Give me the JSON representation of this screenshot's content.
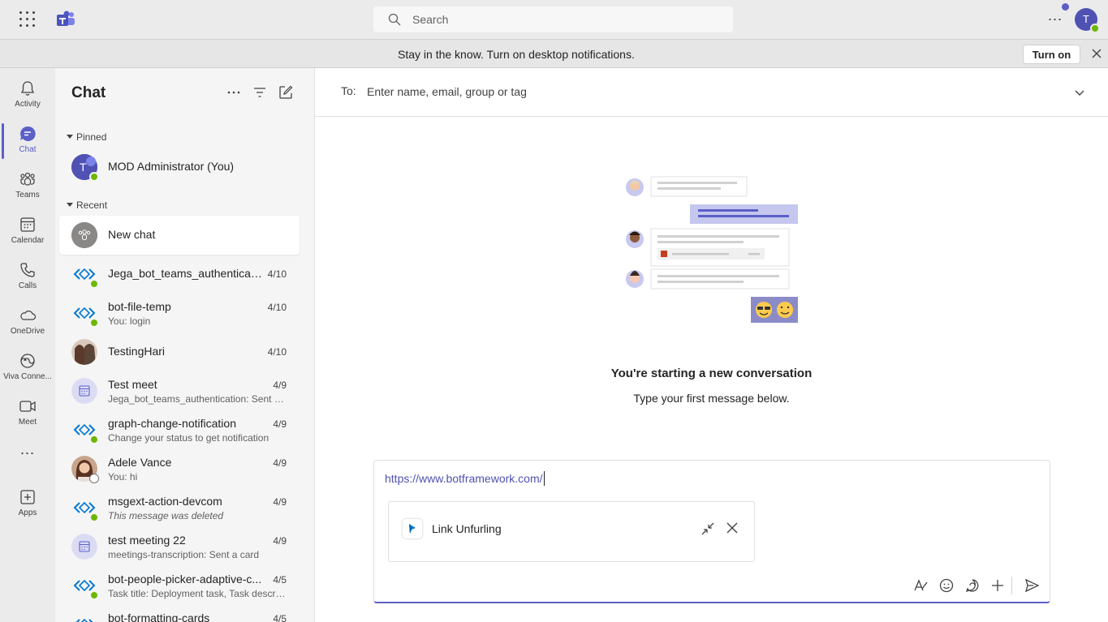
{
  "search": {
    "placeholder": "Search"
  },
  "banner": {
    "text": "Stay in the know. Turn on desktop notifications.",
    "button": "Turn on"
  },
  "user": {
    "initial": "T"
  },
  "rail": [
    {
      "label": "Activity",
      "icon": "bell-icon"
    },
    {
      "label": "Chat",
      "icon": "chat-icon",
      "active": true
    },
    {
      "label": "Teams",
      "icon": "teams-icon"
    },
    {
      "label": "Calendar",
      "icon": "calendar-icon"
    },
    {
      "label": "Calls",
      "icon": "phone-icon"
    },
    {
      "label": "OneDrive",
      "icon": "cloud-icon"
    },
    {
      "label": "Viva Conne...",
      "icon": "viva-icon"
    },
    {
      "label": "Meet",
      "icon": "video-icon"
    },
    {
      "label": "Apps",
      "icon": "add-app-icon"
    }
  ],
  "chatlist": {
    "title": "Chat",
    "pinned_label": "Pinned",
    "recent_label": "Recent",
    "pinned": {
      "name": "MOD Administrator (You)",
      "initial": "T"
    },
    "new_chat": "New chat",
    "items": [
      {
        "name": "Jega_bot_teams_authenticati...",
        "date": "4/10",
        "sub": ""
      },
      {
        "name": "bot-file-temp",
        "date": "4/10",
        "sub": "You: login"
      },
      {
        "name": "TestingHari",
        "date": "4/10",
        "sub": ""
      },
      {
        "name": "Test meet",
        "date": "4/9",
        "sub": "Jega_bot_teams_authentication: Sent a ..."
      },
      {
        "name": "graph-change-notification",
        "date": "4/9",
        "sub": "Change your status to get notification"
      },
      {
        "name": "Adele Vance",
        "date": "4/9",
        "sub": "You: hi"
      },
      {
        "name": "msgext-action-devcom",
        "date": "4/9",
        "sub": "This message was deleted"
      },
      {
        "name": "test meeting 22",
        "date": "4/9",
        "sub": "meetings-transcription: Sent a card"
      },
      {
        "name": "bot-people-picker-adaptive-c...",
        "date": "4/5",
        "sub": "Task title: Deployment task, Task descrip..."
      },
      {
        "name": "bot-formatting-cards",
        "date": "4/5",
        "sub": ""
      }
    ]
  },
  "compose": {
    "to_label": "To:",
    "to_placeholder": "Enter name, email, group or tag",
    "heading": "You're starting a new conversation",
    "subheading": "Type your first message below.",
    "link": "https://www.botframework.com/",
    "card_title": "Link Unfurling"
  },
  "colors": {
    "accent": "#5b5fc7",
    "presence": "#6bb700",
    "link": "#4f52b2"
  }
}
